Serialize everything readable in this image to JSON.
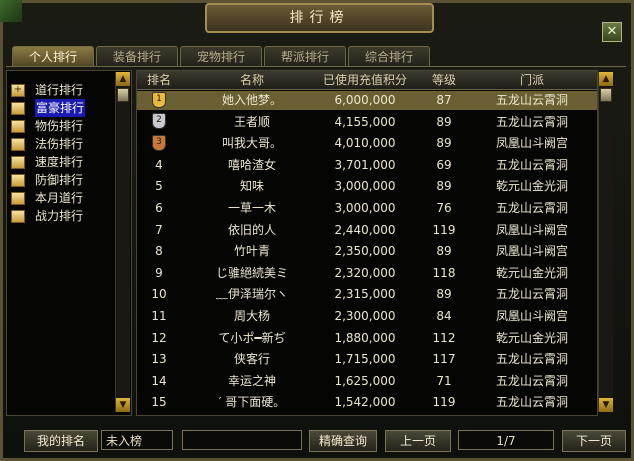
{
  "window": {
    "title": "排行榜",
    "close_symbol": "✕"
  },
  "tabs": [
    {
      "label": "个人排行",
      "active": true
    },
    {
      "label": "装备排行",
      "active": false
    },
    {
      "label": "宠物排行",
      "active": false
    },
    {
      "label": "帮派排行",
      "active": false
    },
    {
      "label": "综合排行",
      "active": false
    }
  ],
  "categories": [
    {
      "label": "道行排行",
      "icon": "plus-icon",
      "selected": false
    },
    {
      "label": "富豪排行",
      "icon": "book-icon",
      "selected": true
    },
    {
      "label": "物伤排行",
      "icon": "book-icon",
      "selected": false
    },
    {
      "label": "法伤排行",
      "icon": "book-icon",
      "selected": false
    },
    {
      "label": "速度排行",
      "icon": "book-icon",
      "selected": false
    },
    {
      "label": "防御排行",
      "icon": "book-icon",
      "selected": false
    },
    {
      "label": "本月道行",
      "icon": "book-icon",
      "selected": false
    },
    {
      "label": "战力排行",
      "icon": "book-icon",
      "selected": false
    }
  ],
  "table": {
    "headers": [
      "排名",
      "名称",
      "已使用充值积分",
      "等级",
      "门派"
    ],
    "rows": [
      {
        "rank": "1",
        "medal": "gold",
        "name": "她入他梦。",
        "points": "6,000,000",
        "level": "87",
        "faction": "五龙山云霄洞"
      },
      {
        "rank": "2",
        "medal": "silver",
        "name": "王者顺",
        "points": "4,155,000",
        "level": "89",
        "faction": "五龙山云霄洞"
      },
      {
        "rank": "3",
        "medal": "bronze",
        "name": "叫我大哥。",
        "points": "4,010,000",
        "level": "89",
        "faction": "凤凰山斗阙宫"
      },
      {
        "rank": "4",
        "medal": "",
        "name": "嘻哈渣女",
        "points": "3,701,000",
        "level": "69",
        "faction": "五龙山云霄洞"
      },
      {
        "rank": "5",
        "medal": "",
        "name": "知味",
        "points": "3,000,000",
        "level": "89",
        "faction": "乾元山金光洞"
      },
      {
        "rank": "6",
        "medal": "",
        "name": "一草一木",
        "points": "3,000,000",
        "level": "76",
        "faction": "五龙山云霄洞"
      },
      {
        "rank": "7",
        "medal": "",
        "name": "依旧的人",
        "points": "2,440,000",
        "level": "119",
        "faction": "凤凰山斗阙宫"
      },
      {
        "rank": "8",
        "medal": "",
        "name": "竹叶青",
        "points": "2,350,000",
        "level": "89",
        "faction": "凤凰山斗阙宫"
      },
      {
        "rank": "9",
        "medal": "",
        "name": "じ骓絕続美ミ",
        "points": "2,320,000",
        "level": "118",
        "faction": "乾元山金光洞"
      },
      {
        "rank": "10",
        "medal": "",
        "name": "﹏伊泽瑞尔ヽ",
        "points": "2,315,000",
        "level": "89",
        "faction": "五龙山云霄洞"
      },
      {
        "rank": "11",
        "medal": "",
        "name": "周大杨",
        "points": "2,300,000",
        "level": "84",
        "faction": "凤凰山斗阙宫"
      },
      {
        "rank": "12",
        "medal": "",
        "name": "て小ポ━新ぢ",
        "points": "1,880,000",
        "level": "112",
        "faction": "乾元山金光洞"
      },
      {
        "rank": "13",
        "medal": "",
        "name": "侠客行",
        "points": "1,715,000",
        "level": "117",
        "faction": "五龙山云霄洞"
      },
      {
        "rank": "14",
        "medal": "",
        "name": "幸运之神",
        "points": "1,625,000",
        "level": "71",
        "faction": "五龙山云霄洞"
      },
      {
        "rank": "15",
        "medal": "",
        "name": "′ 哥下面硬。",
        "points": "1,542,000",
        "level": "119",
        "faction": "五龙山云霄洞"
      }
    ]
  },
  "footer": {
    "my_rank_label": "我的排名",
    "my_rank_value": "未入榜",
    "search_value": "",
    "search_button": "精确查询",
    "prev_button": "上一页",
    "page_indicator": "1/7",
    "next_button": "下一页"
  },
  "colors": {
    "gold": "#e8b93a",
    "silver": "#c7c9cf",
    "bronze": "#c8783a",
    "selected_row": "#6a5f33",
    "selected_category": "#1a1ab0"
  }
}
